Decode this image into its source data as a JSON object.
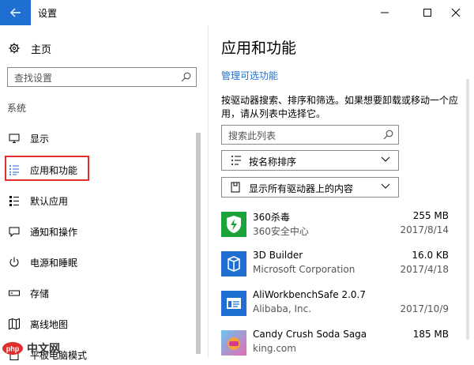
{
  "window": {
    "title": "设置"
  },
  "left": {
    "home_label": "主页",
    "search_placeholder": "查找设置",
    "section_label": "系统",
    "nav": [
      {
        "label": "显示",
        "icon": "monitor-icon"
      },
      {
        "label": "应用和功能",
        "icon": "apps-list-icon"
      },
      {
        "label": "默认应用",
        "icon": "default-apps-icon"
      },
      {
        "label": "通知和操作",
        "icon": "notification-icon"
      },
      {
        "label": "电源和睡眠",
        "icon": "power-icon"
      },
      {
        "label": "存储",
        "icon": "storage-icon"
      },
      {
        "label": "离线地图",
        "icon": "map-icon"
      },
      {
        "label": "平板电脑模式",
        "icon": "tablet-icon"
      }
    ],
    "active_index": 1
  },
  "right": {
    "title": "应用和功能",
    "manage_link": "管理可选功能",
    "description": "按驱动器搜索、排序和筛选。如果想要卸载或移动一个应用，请从列表中选择它。",
    "search_placeholder": "搜索此列表",
    "sort_label": "按名称排序",
    "filter_label": "显示所有驱动器上的内容",
    "apps": [
      {
        "name": "360杀毒",
        "publisher": "360安全中心",
        "size": "255 MB",
        "date": "2017/8/14",
        "icon": "shield-icon",
        "color": "#1aa33b"
      },
      {
        "name": "3D Builder",
        "publisher": "Microsoft Corporation",
        "size": "16.0 KB",
        "date": "2017/4/18",
        "icon": "cube-icon",
        "color": "#1e6fd0"
      },
      {
        "name": "AliWorkbenchSafe 2.0.7",
        "publisher": "Alibaba, Inc.",
        "size": "",
        "date": "2017/10/9",
        "icon": "window-icon",
        "color": "#1e6fd0"
      },
      {
        "name": "Candy Crush Soda Saga",
        "publisher": "king.com",
        "size": "185 MB",
        "date": "",
        "icon": "candy-icon",
        "color": "#e56bb2"
      }
    ]
  },
  "watermark": {
    "text": "中文网",
    "logo_text": "php"
  },
  "colors": {
    "accent": "#1e6fd0",
    "highlight": "#e02d2d"
  }
}
